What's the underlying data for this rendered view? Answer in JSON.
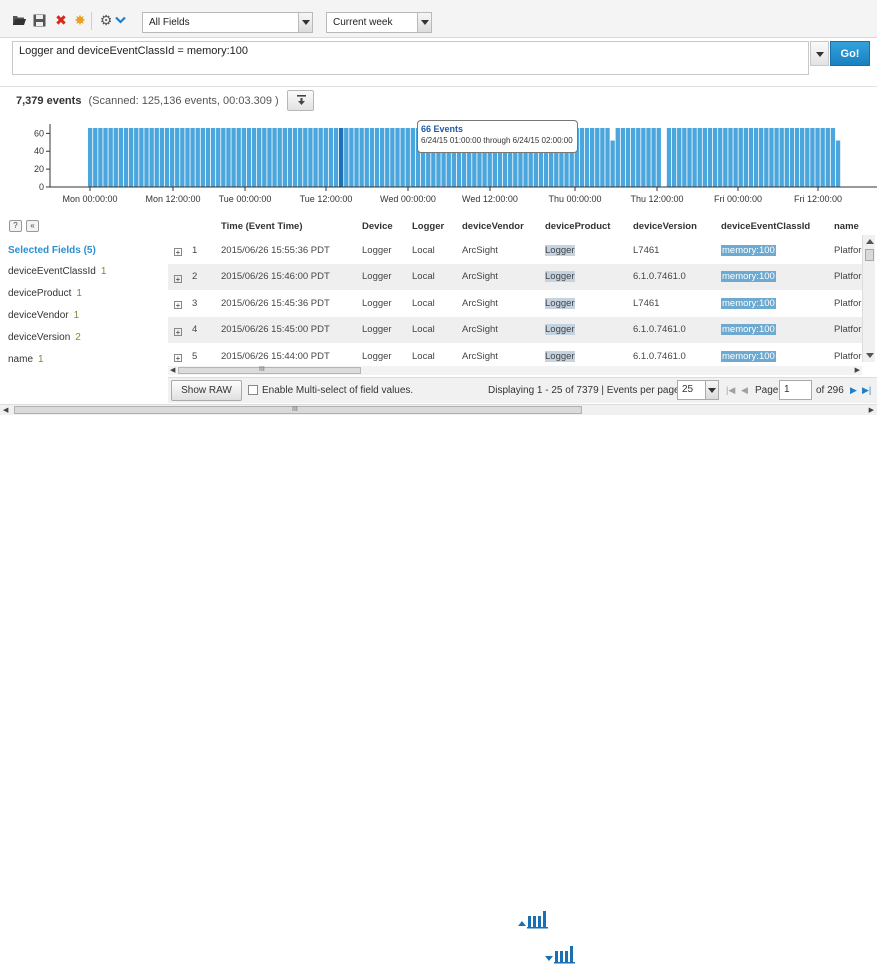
{
  "toolbar": {
    "icons": [
      "folder-open-icon",
      "save-icon",
      "delete-icon",
      "magic-wand-icon",
      "gear-icon",
      "chevron-down-icon"
    ],
    "field_set": "All Fields",
    "time_range": "Current week"
  },
  "query": {
    "text": "Logger and deviceEventClassId = memory:100",
    "go_label": "Go!"
  },
  "summary": {
    "count": "7,379 events",
    "scanned": "(Scanned: 125,136 events,  00:03.309 )"
  },
  "histogram": {
    "y_ticks": [
      "60",
      "40",
      "20",
      "0"
    ],
    "x_ticks": [
      "Mon 00:00:00",
      "Mon 12:00:00",
      "Tue 00:00:00",
      "Tue 12:00:00",
      "Wed 00:00:00",
      "Wed 12:00:00",
      "Thu 00:00:00",
      "Thu 12:00:00",
      "Fri 00:00:00",
      "Fri 12:00:00"
    ],
    "bar_color": "#4aa6dc",
    "highlight_color": "#1e73b8",
    "tooltip": {
      "title": "66 Events",
      "range": "6/24/15 01:00:00 through 6/24/15 02:00:00"
    }
  },
  "chart_data": {
    "type": "bar",
    "ylim": [
      0,
      66
    ],
    "x": [
      "Mon 00:00:00",
      "Mon 12:00:00",
      "Tue 00:00:00",
      "Tue 12:00:00",
      "Wed 00:00:00",
      "Wed 12:00:00",
      "Thu 00:00:00",
      "Thu 12:00:00",
      "Fri 00:00:00",
      "Fri 12:00:00"
    ],
    "hourly_values": [
      66,
      66,
      66,
      66,
      66,
      66,
      66,
      66,
      66,
      66,
      66,
      66,
      66,
      66,
      66,
      66,
      66,
      66,
      66,
      66,
      66,
      66,
      66,
      66,
      66,
      66,
      66,
      66,
      66,
      66,
      66,
      66,
      66,
      66,
      66,
      66,
      66,
      66,
      66,
      66,
      66,
      66,
      66,
      66,
      66,
      66,
      66,
      66,
      66,
      66,
      66,
      66,
      66,
      66,
      66,
      66,
      66,
      66,
      66,
      66,
      66,
      66,
      66,
      66,
      66,
      66,
      66,
      66,
      66,
      66,
      66,
      66,
      66,
      66,
      66,
      66,
      66,
      66,
      66,
      66,
      66,
      66,
      66,
      66,
      66,
      66,
      66,
      66,
      66,
      66,
      66,
      66,
      66,
      66,
      66,
      66,
      66,
      66,
      66,
      66,
      66,
      66,
      52,
      66,
      66,
      66,
      66,
      66,
      66,
      66,
      66,
      66,
      0,
      66,
      66,
      66,
      66,
      66,
      66,
      66,
      66,
      66,
      66,
      66,
      66,
      66,
      66,
      66,
      66,
      66,
      66,
      66,
      66,
      66,
      66,
      66,
      66,
      66,
      66,
      66,
      66,
      66,
      66,
      66,
      66,
      66,
      52
    ],
    "highlight_index": 49
  },
  "panel": {
    "help_label": "?",
    "collapse_label": "«",
    "title": "Selected Fields (5)",
    "fields": [
      {
        "name": "deviceEventClassId",
        "count": "1"
      },
      {
        "name": "deviceProduct",
        "count": "1"
      },
      {
        "name": "deviceVendor",
        "count": "1"
      },
      {
        "name": "deviceVersion",
        "count": "2"
      },
      {
        "name": "name",
        "count": "1"
      }
    ]
  },
  "table": {
    "headers": [
      "Time (Event Time)",
      "Device",
      "Logger",
      "deviceVendor",
      "deviceProduct",
      "deviceVersion",
      "deviceEventClassId",
      "name"
    ],
    "expander": "+",
    "rows": [
      {
        "n": "1",
        "time": "2015/06/26 15:55:36 PDT",
        "device": "Logger",
        "logger": "Local",
        "vendor": "ArcSight",
        "product": "Logger",
        "version": "L7461",
        "classid": "memory:100",
        "name": "Platfor"
      },
      {
        "n": "2",
        "time": "2015/06/26 15:46:00 PDT",
        "device": "Logger",
        "logger": "Local",
        "vendor": "ArcSight",
        "product": "Logger",
        "version": "6.1.0.7461.0",
        "classid": "memory:100",
        "name": "Platfor"
      },
      {
        "n": "3",
        "time": "2015/06/26 15:45:36 PDT",
        "device": "Logger",
        "logger": "Local",
        "vendor": "ArcSight",
        "product": "Logger",
        "version": "L7461",
        "classid": "memory:100",
        "name": "Platfor"
      },
      {
        "n": "4",
        "time": "2015/06/26 15:45:00 PDT",
        "device": "Logger",
        "logger": "Local",
        "vendor": "ArcSight",
        "product": "Logger",
        "version": "6.1.0.7461.0",
        "classid": "memory:100",
        "name": "Platfor"
      },
      {
        "n": "5",
        "time": "2015/06/26 15:44:00 PDT",
        "device": "Logger",
        "logger": "Local",
        "vendor": "ArcSight",
        "product": "Logger",
        "version": "6.1.0.7461.0",
        "classid": "memory:100",
        "name": "Platfor"
      }
    ]
  },
  "footer": {
    "show_raw": "Show RAW",
    "multi_select": "Enable Multi-select of field values.",
    "displaying": "Displaying 1 - 25 of 7379  |  Events per page",
    "per_page": "25",
    "page_label": "Page",
    "page_value": "1",
    "of_pages": "of 296"
  },
  "scrollbar": {
    "grip": "III"
  }
}
